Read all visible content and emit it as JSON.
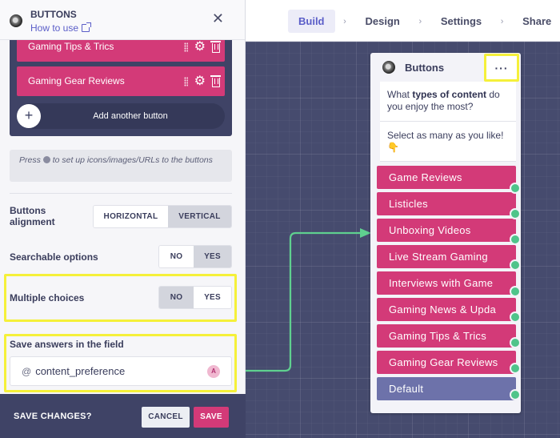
{
  "panel": {
    "title": "BUTTONS",
    "how_to_use": "How to use",
    "close_icon": "close-icon",
    "buttons": [
      {
        "label": "Gaming Tips & Trics"
      },
      {
        "label": "Gaming Gear Reviews"
      }
    ],
    "add_button_label": "Add another button",
    "hint_prefix": "Press",
    "hint_suffix": "to set up icons/images/URLs to the buttons",
    "alignment": {
      "label": "Buttons alignment",
      "options": [
        "HORIZONTAL",
        "VERTICAL"
      ],
      "selected": "VERTICAL"
    },
    "searchable": {
      "label": "Searchable options",
      "options": [
        "NO",
        "YES"
      ],
      "selected": "YES"
    },
    "multiple": {
      "label": "Multiple choices",
      "options": [
        "NO",
        "YES"
      ],
      "selected": "NO"
    },
    "save_field": {
      "label": "Save answers in the field",
      "prefix": "@",
      "value": "content_preference",
      "badge": "A"
    },
    "footer": {
      "label": "SAVE CHANGES?",
      "cancel": "CANCEL",
      "save": "SAVE"
    }
  },
  "nav": {
    "items": [
      {
        "label": "Build",
        "active": true
      },
      {
        "label": "Design",
        "active": false
      },
      {
        "label": "Settings",
        "active": false
      },
      {
        "label": "Share",
        "active": false
      }
    ],
    "separator": "›"
  },
  "block": {
    "title": "Buttons",
    "more": "···",
    "message_1_pre": "What ",
    "message_1_bold": "types of content",
    "message_1_post": " do you enjoy the most?",
    "message_2": "Select as many as you like!",
    "message_2_emoji": "👇",
    "choices": [
      "Game Reviews",
      "Listicles",
      "Unboxing Videos",
      "Live Stream Gaming",
      "Interviews with Game",
      "Gaming News & Upda",
      "Gaming Tips & Trics",
      "Gaming Gear Reviews"
    ],
    "default_choice": "Default"
  },
  "colors": {
    "accent": "#d33a78",
    "default_choice": "#6d72aa",
    "port": "#4fc48a",
    "canvas": "#464b6e",
    "highlight": "#f5f03a",
    "link": "#5a5dc8"
  }
}
